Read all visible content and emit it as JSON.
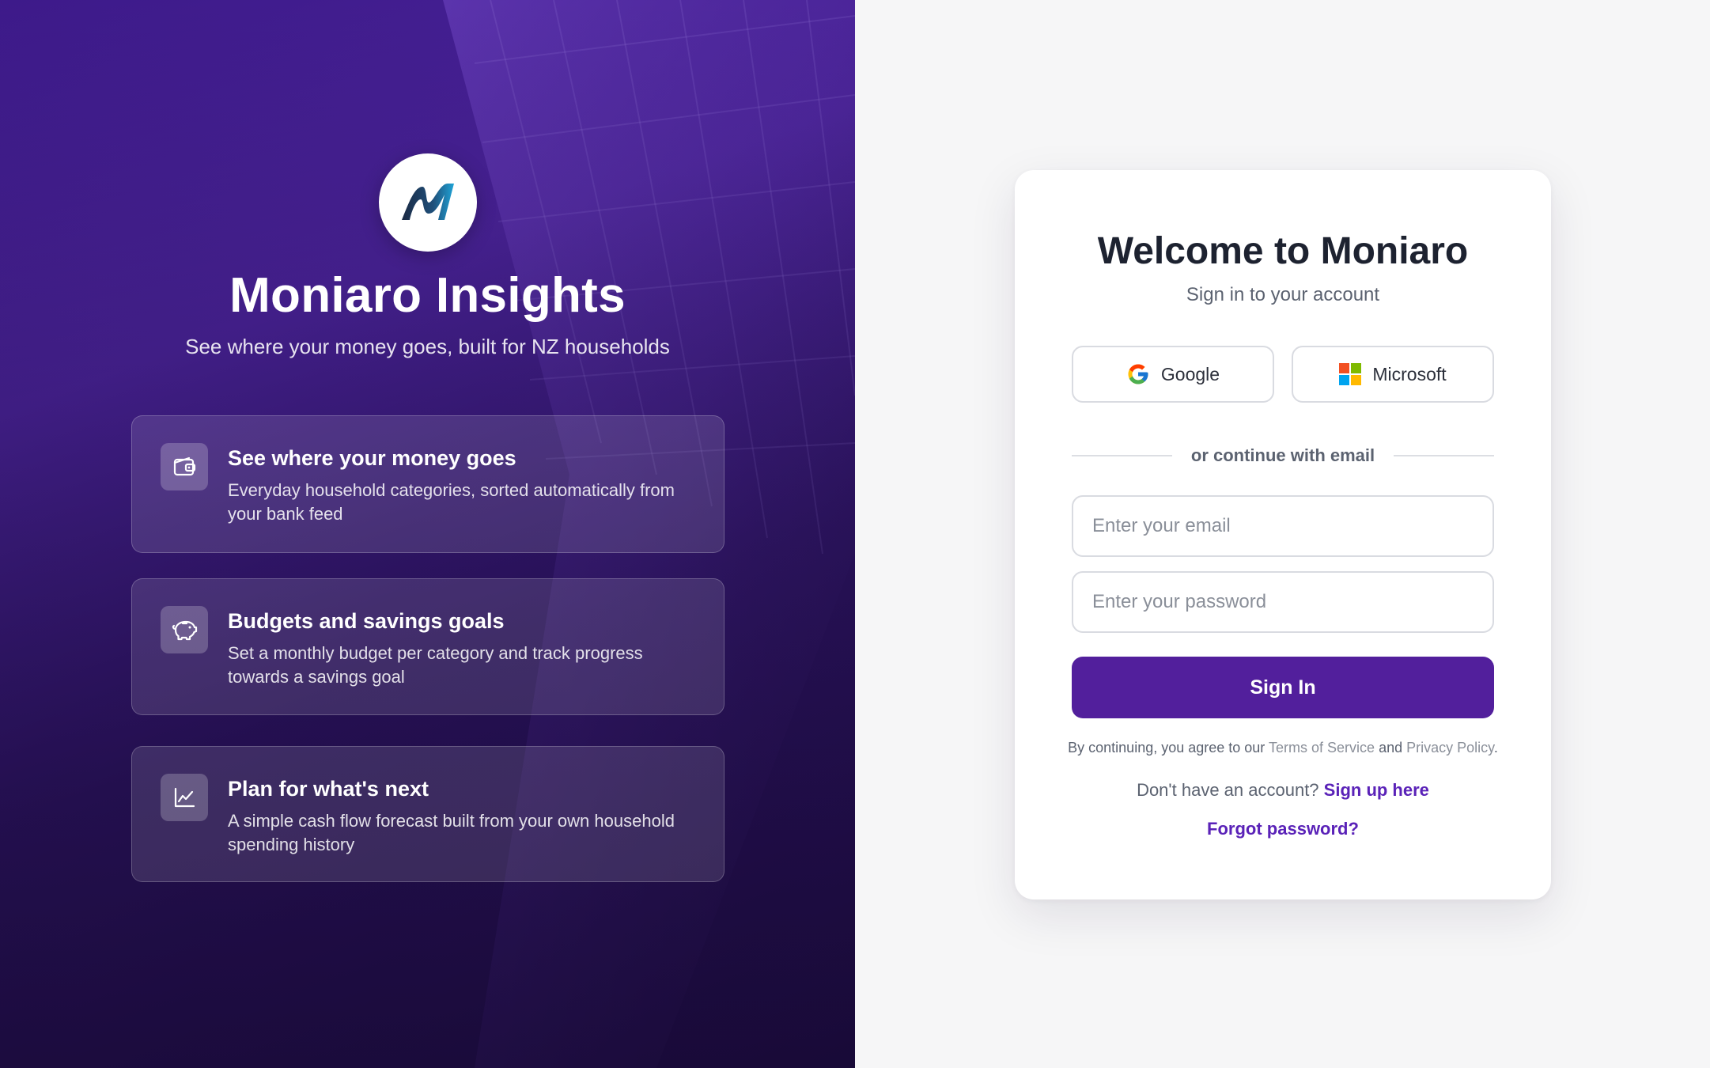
{
  "brand": {
    "title": "Moniaro Insights",
    "subtitle": "See where your money goes, built for NZ households",
    "logo_icon": "moniaro-m-logo"
  },
  "features": [
    {
      "icon": "wallet-icon",
      "title": "See where your money goes",
      "description": "Everyday household categories, sorted automatically from your bank feed"
    },
    {
      "icon": "piggy-bank-icon",
      "title": "Budgets and savings goals",
      "description": "Set a monthly budget per category and track progress towards a savings goal"
    },
    {
      "icon": "line-chart-icon",
      "title": "Plan for what's next",
      "description": "A simple cash flow forecast built from your own household spending history"
    }
  ],
  "login": {
    "title": "Welcome to Moniaro",
    "subtitle": "Sign in to your account",
    "google_label": "Google",
    "microsoft_label": "Microsoft",
    "divider_text": "or continue with email",
    "email_placeholder": "Enter your email",
    "password_placeholder": "Enter your password",
    "signin_label": "Sign In",
    "legal_prefix": "By continuing, you agree to our",
    "terms_label": "Terms of Service",
    "legal_and": "and",
    "privacy_label": "Privacy Policy",
    "legal_suffix": ".",
    "signup_prompt": "Don't have an account?",
    "signup_link": "Sign up here",
    "forgot_link": "Forgot password?"
  },
  "colors": {
    "primary": "#521f9c",
    "link": "#5a22b8",
    "panel_dark": "#2e1466"
  }
}
